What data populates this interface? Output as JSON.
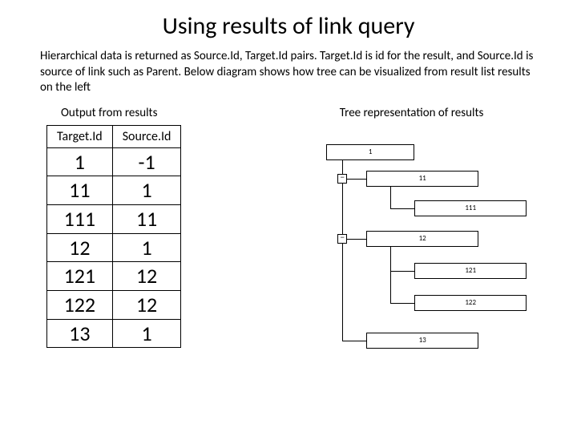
{
  "title": "Using results of link query",
  "description": "Hierarchical data is returned as Source.Id, Target.Id pairs. Target.Id is id for the result, and Source.Id is source of link such as Parent. Below diagram shows how tree can be visualized from result list results on the left",
  "left_subtitle": "Output from results",
  "right_subtitle": "Tree representation of results",
  "table": {
    "headers": {
      "target": "Target.Id",
      "source": "Source.Id"
    },
    "rows": [
      {
        "target": "1",
        "source": "-1"
      },
      {
        "target": "11",
        "source": "1"
      },
      {
        "target": "111",
        "source": "11"
      },
      {
        "target": "12",
        "source": "1"
      },
      {
        "target": "121",
        "source": "12"
      },
      {
        "target": "122",
        "source": "12"
      },
      {
        "target": "13",
        "source": "1"
      }
    ]
  },
  "tree": {
    "toggle_glyph": "−",
    "nodes": {
      "n1": "1",
      "n11": "11",
      "n111": "111",
      "n12": "12",
      "n121": "121",
      "n122": "122",
      "n13": "13"
    }
  }
}
